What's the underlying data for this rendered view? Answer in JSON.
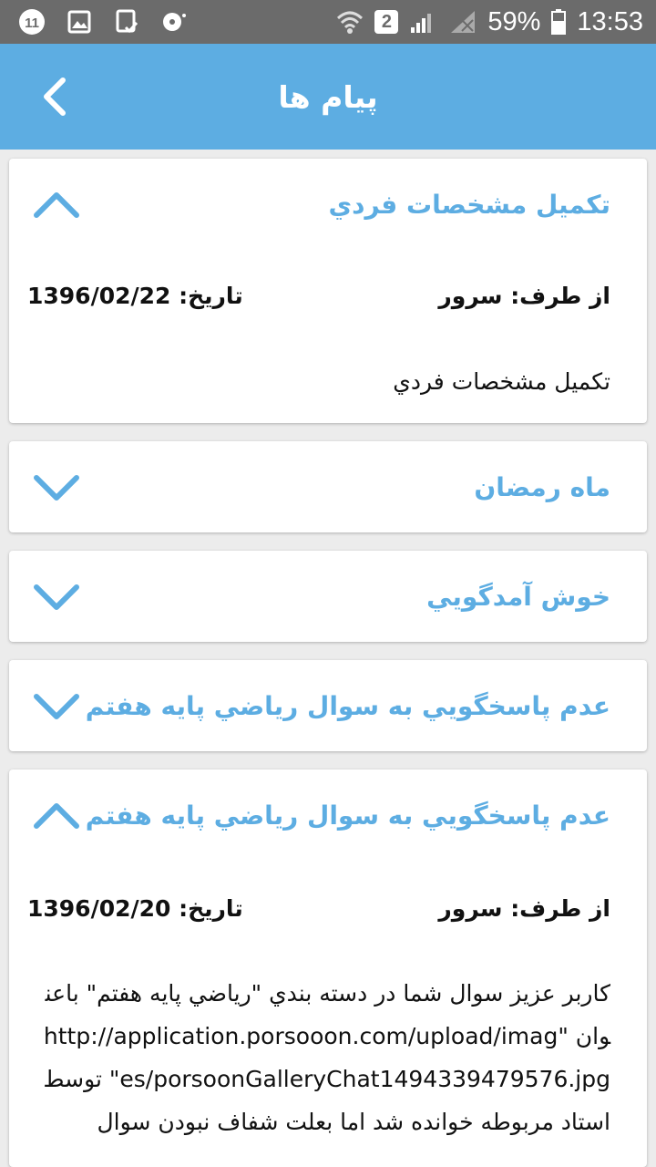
{
  "status_bar": {
    "notification_count": "11",
    "sim_number": "2",
    "battery": "59%",
    "time": "13:53"
  },
  "app_bar": {
    "title": "پیام ها",
    "back_icon": "chevron-left-icon"
  },
  "messages": [
    {
      "title": "تكميل مشخصات فردي",
      "expanded": true,
      "from_label": "از طرف:",
      "from_value": "سرور",
      "date_label": "تاريخ:",
      "date_value": "1396/02/22",
      "body": "تكميل مشخصات فردي"
    },
    {
      "title": "ماه رمضان",
      "expanded": false
    },
    {
      "title": "خوش آمدگويي",
      "expanded": false
    },
    {
      "title": "عدم پاسخگويي به سوال رياضي پايه هفتم",
      "expanded": false
    },
    {
      "title": "عدم پاسخگويي به سوال رياضي پايه هفتم",
      "expanded": true,
      "from_label": "از طرف:",
      "from_value": "سرور",
      "date_label": "تاريخ:",
      "date_value": "1396/02/20",
      "body": "كاربر عزيز سوال شما در دسته بندي \"رياضي پايه هفتم\" باعنوان \"http://application.porsooon.com/upload/images/porsoonGalleryChat1494339479576.jpg\" توسط استاد مربوطه خوانده شد اما بعلت شفاف نبودن سوال"
    }
  ],
  "colors": {
    "accent": "#5dade2",
    "status_bar": "#6b6b6b",
    "background": "#ececec"
  }
}
